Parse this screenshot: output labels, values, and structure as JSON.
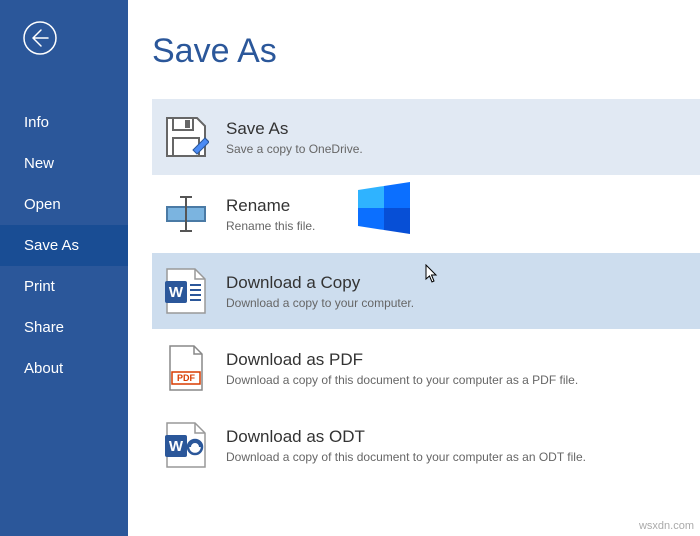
{
  "colors": {
    "brand": "#2b579a",
    "brand_dark": "#194d94",
    "highlight": "#e1e9f3",
    "hover": "#cdddee"
  },
  "page": {
    "title": "Save As"
  },
  "sidebar": {
    "items": [
      {
        "label": "Info",
        "active": false
      },
      {
        "label": "New",
        "active": false
      },
      {
        "label": "Open",
        "active": false
      },
      {
        "label": "Save As",
        "active": true
      },
      {
        "label": "Print",
        "active": false
      },
      {
        "label": "Share",
        "active": false
      },
      {
        "label": "About",
        "active": false
      }
    ]
  },
  "options": [
    {
      "icon": "save-as-icon",
      "title": "Save As",
      "desc": "Save a copy to OneDrive.",
      "state": "highlight"
    },
    {
      "icon": "rename-icon",
      "title": "Rename",
      "desc": "Rename this file.",
      "state": "normal"
    },
    {
      "icon": "word-doc-icon",
      "title": "Download a Copy",
      "desc": "Download a copy to your computer.",
      "state": "hover"
    },
    {
      "icon": "pdf-icon",
      "title": "Download as PDF",
      "desc": "Download a copy of this document to your computer as a PDF file.",
      "state": "normal"
    },
    {
      "icon": "odt-icon",
      "title": "Download as ODT",
      "desc": "Download a copy of this document to your computer as an ODT file.",
      "state": "normal"
    }
  ],
  "watermark": "wsxdn.com"
}
